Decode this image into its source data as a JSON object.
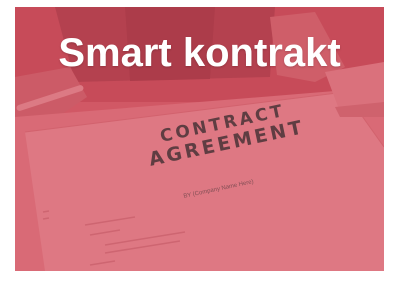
{
  "headline": "Smart kontrakt",
  "document": {
    "title_line1": "CONTRACT",
    "title_line2": "AGREEMENT",
    "subtitle": "BY (Company Name Here)"
  },
  "colors": {
    "overlay": "#d43a4a",
    "headline_text": "#ffffff"
  }
}
